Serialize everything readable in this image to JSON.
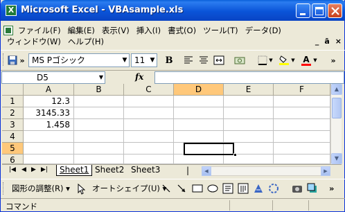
{
  "window": {
    "title": "Microsoft Excel - VBAsample.xls",
    "app_icon": "X"
  },
  "menu": {
    "row1": [
      "ファイル(F)",
      "編集(E)",
      "表示(V)",
      "挿入(I)",
      "書式(O)",
      "ツール(T)",
      "データ(D)"
    ],
    "row2": [
      "ウィンドウ(W)",
      "ヘルプ(H)"
    ],
    "mdi_controls": [
      "_",
      "ā",
      "×"
    ]
  },
  "toolbar": {
    "font_name": "MS Pゴシック",
    "font_size": "11",
    "bold": "B",
    "icons": [
      "save-icon",
      "align-left-icon",
      "align-center-icon",
      "merge-center-icon",
      "currency-icon",
      "borders-icon",
      "fill-color-icon",
      "font-color-icon"
    ],
    "font_color_label": "A",
    "fill_color": "#ffff00",
    "font_color": "#ff0000",
    "overflow": "»"
  },
  "formula_bar": {
    "name_box": "D5",
    "fx": "fx",
    "content": ""
  },
  "grid": {
    "columns": [
      "A",
      "B",
      "C",
      "D",
      "E",
      "F"
    ],
    "rows": [
      "1",
      "2",
      "3",
      "4",
      "5",
      "6"
    ],
    "active_cell": "D5",
    "cells": {
      "A1": "12.3",
      "A2": "3145.33",
      "A3": "1.458"
    }
  },
  "sheets": {
    "tabs": [
      "Sheet1",
      "Sheet2",
      "Sheet3"
    ],
    "active": "Sheet1"
  },
  "drawing_toolbar": {
    "draw_menu": "図形の調整(R)",
    "autoshape_menu": "オートシェイプ(U)",
    "icons": [
      "pointer-icon",
      "line-icon",
      "arrow-icon",
      "rectangle-icon",
      "oval-icon",
      "textbox-icon",
      "vertical-textbox-icon",
      "wordart-icon",
      "diagram-icon",
      "clipart-icon",
      "shadow-icon",
      "3d-icon"
    ]
  },
  "status": {
    "text": "コマンド"
  }
}
